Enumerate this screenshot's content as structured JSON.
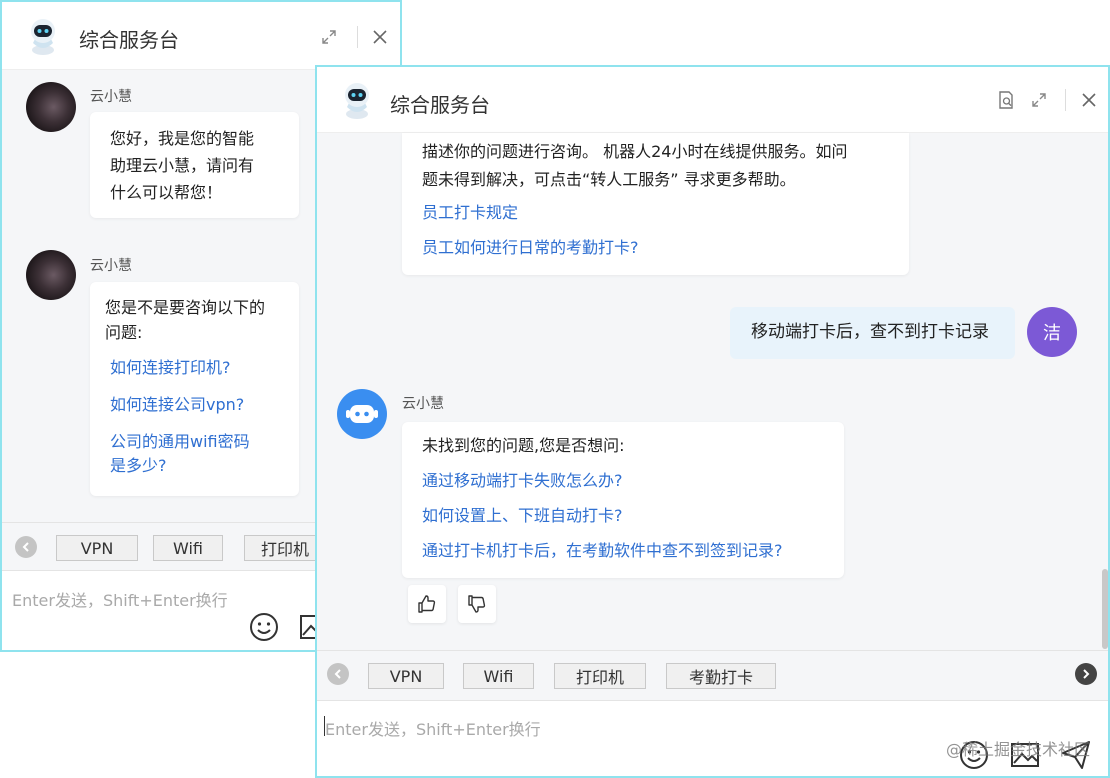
{
  "window1": {
    "title": "综合服务台",
    "messages": [
      {
        "sender": "云小慧",
        "lines": [
          "您好，我是您的智能",
          "助理云小慧，请问有",
          "什么可以帮您！"
        ]
      },
      {
        "sender": "云小慧",
        "lines": [
          "您是不是要咨询以下的",
          "问题:"
        ],
        "links": [
          "如何连接打印机?",
          "如何连接公司vpn?",
          "公司的通用wifi密码",
          "是多少?"
        ]
      }
    ],
    "chips": [
      "VPN",
      "Wifi",
      "打印机"
    ],
    "input_placeholder": "Enter发送，Shift+Enter换行"
  },
  "window2": {
    "title": "综合服务台",
    "bot_intro": {
      "lines": [
        "描述你的问题进行咨询。 机器人24小时在线提供服务。如问",
        "题未得到解决，可点击“转人工服务” 寻求更多帮助。"
      ],
      "links": [
        "员工打卡规定",
        "员工如何进行日常的考勤打卡?"
      ]
    },
    "user_message": {
      "text": "移动端打卡后，查不到打卡记录",
      "avatar_label": "洁"
    },
    "bot_reply": {
      "sender": "云小慧",
      "lead": "未找到您的问题,您是否想问:",
      "links": [
        "通过移动端打卡失败怎么办?",
        "如何设置上、下班自动打卡?",
        "通过打卡机打卡后，在考勤软件中查不到签到记录?"
      ]
    },
    "chips": [
      "VPN",
      "Wifi",
      "打印机",
      "考勤打卡"
    ],
    "input_placeholder": "Enter发送，Shift+Enter换行"
  },
  "watermark": "@稀土掘金技术社区",
  "colors": {
    "border": "#8fe3ee",
    "link": "#2f6fd1",
    "user_avatar": "#7c59d6",
    "bot_avatar": "#3a8ef0",
    "user_bubble": "#e8f3fb"
  }
}
